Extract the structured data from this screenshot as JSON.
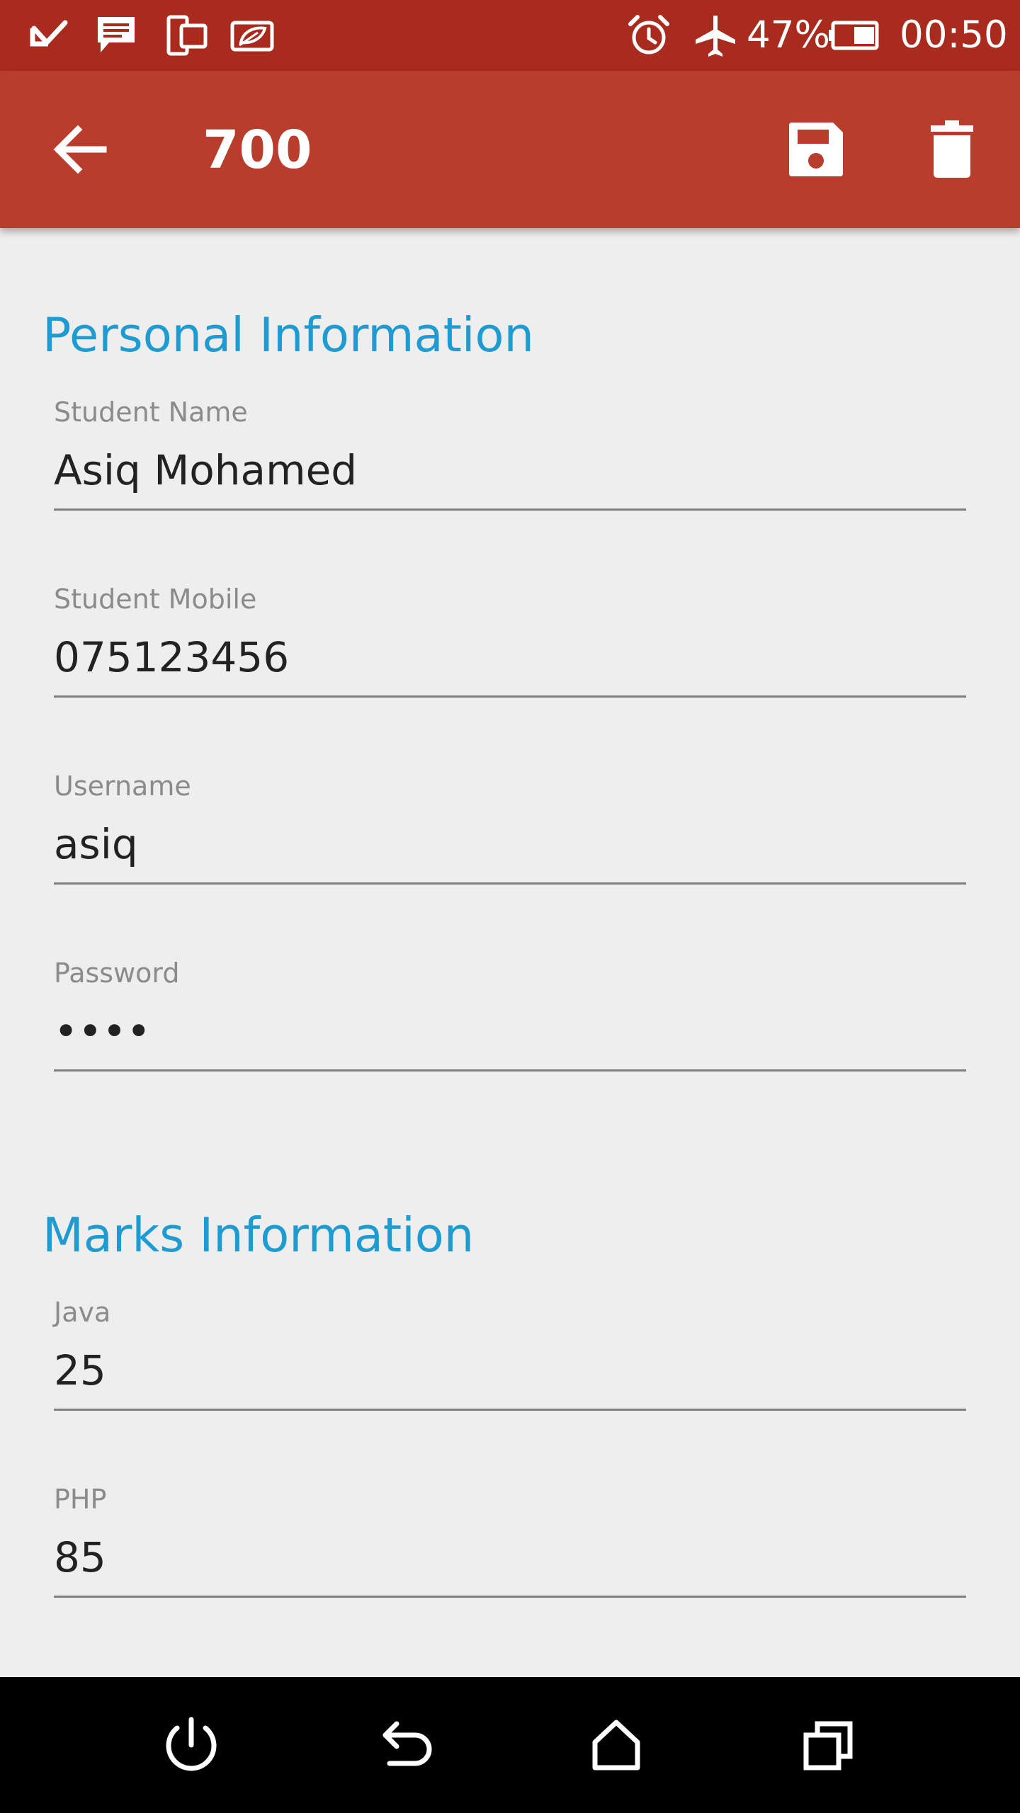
{
  "status_bar": {
    "icons": [
      "missed-call-icon",
      "message-icon",
      "phone-tablet-icon",
      "eco-leaf-icon",
      "alarm-icon",
      "airplane-mode-icon",
      "battery-icon"
    ],
    "battery_percent": "47%",
    "time": "00:50"
  },
  "toolbar": {
    "title": "700",
    "back_icon": "arrow-back-icon",
    "save_icon": "save-icon",
    "delete_icon": "delete-icon"
  },
  "personal_section": {
    "title": "Personal Information",
    "fields": [
      {
        "label": "Student Name",
        "value": "Asiq Mohamed"
      },
      {
        "label": "Student Mobile",
        "value": "075123456"
      },
      {
        "label": "Username",
        "value": "asiq"
      },
      {
        "label": "Password",
        "value": "••••"
      }
    ]
  },
  "marks_section": {
    "title": "Marks Information",
    "fields": [
      {
        "label": "Java",
        "value": "25"
      },
      {
        "label": "PHP",
        "value": "85"
      }
    ]
  },
  "nav_bar": {
    "icons": [
      "power-icon",
      "back-icon",
      "home-icon",
      "recents-icon"
    ]
  },
  "colors": {
    "status_bar": "#a92b1e",
    "toolbar": "#b93d2d",
    "section_title": "#1e9bd0",
    "background": "#eeeeee"
  }
}
